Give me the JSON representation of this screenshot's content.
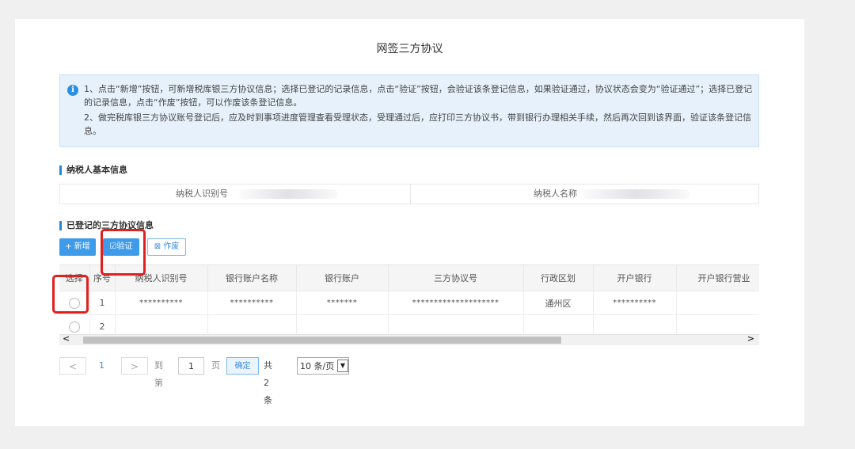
{
  "page": {
    "title": "网签三方协议"
  },
  "notice": {
    "icon": "info-icon",
    "line1": "1、点击“新增”按钮，可新增税库银三方协议信息；选择已登记的记录信息，点击“验证”按钮，会验证该条登记信息，如果验证通过，协议状态会变为“验证通过”；选择已登记的记录信息，点击“作废”按钮，可以作废该条登记信息。",
    "line2": "2、做完税库银三方协议账号登记后，应及时到事项进度管理查看受理状态，受理通过后，应打印三方协议书，带到银行办理相关手续，然后再次回到该界面，验证该条登记信息。"
  },
  "taxpayer_section": {
    "title": "纳税人基本信息",
    "id_label": "纳税人识别号",
    "name_label": "纳税人名称"
  },
  "registered_section": {
    "title": "已登记的三方协议信息"
  },
  "toolbar": {
    "add_label": "+ 新增",
    "verify_label": "验证",
    "void_label": "作废"
  },
  "table": {
    "columns": [
      "选择",
      "序号",
      "纳税人识别号",
      "银行账户名称",
      "银行账户",
      "三方协议号",
      "行政区划",
      "开户银行",
      "开户银行营业"
    ],
    "rows": [
      {
        "index": "1",
        "taxpayer_id": "**********",
        "account_name": "**********",
        "account": "*******",
        "agreement_no": "********************",
        "region": "通州区",
        "bank": "**********",
        "branch": ""
      },
      {
        "index": "2",
        "taxpayer_id": "",
        "account_name": "",
        "account": "",
        "agreement_no": "",
        "region": "",
        "bank": "",
        "branch": ""
      }
    ]
  },
  "pagination": {
    "prev": "<",
    "current": "1",
    "next": ">",
    "goto_label": "到第",
    "goto_value": "1",
    "page_unit": "页",
    "confirm_label": "确定",
    "total_label": "共 2 条",
    "page_size": "10 条/页"
  },
  "colors": {
    "accent": "#3d9be9",
    "highlight": "#e0201f",
    "notice_bg": "#e6f1fb"
  }
}
